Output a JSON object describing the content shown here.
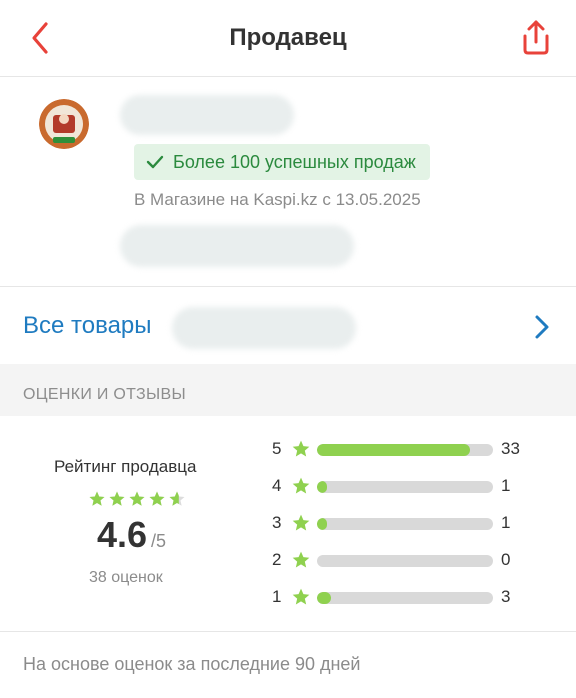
{
  "header": {
    "title": "Продавец"
  },
  "seller": {
    "badge": "Более 100 успешных продаж",
    "since": "В Магазине на Kaspi.kz с 13.05.2025"
  },
  "all_goods": {
    "label": "Все товары"
  },
  "reviews": {
    "section_title": "ОЦЕНКИ И ОТЗЫВЫ",
    "rating_title": "Рейтинг продавца",
    "score": "4.6",
    "score_max": "/5",
    "count": "38 оценок",
    "stars_filled": 4.6,
    "distribution": [
      {
        "stars": "5",
        "count": "33",
        "fraction": 0.87
      },
      {
        "stars": "4",
        "count": "1",
        "fraction": 0.03
      },
      {
        "stars": "3",
        "count": "1",
        "fraction": 0.03
      },
      {
        "stars": "2",
        "count": "0",
        "fraction": 0.0
      },
      {
        "stars": "1",
        "count": "3",
        "fraction": 0.08
      }
    ],
    "note": "На основе оценок за последние 90 дней"
  },
  "colors": {
    "accent_red": "#e8423a",
    "link_blue": "#1f7bc0",
    "star_green": "#8fd14f",
    "badge_green": "#2b8a3e"
  },
  "icons": [
    "back-arrow-icon",
    "share-icon",
    "check-icon",
    "star-icon",
    "chevron-right-icon"
  ]
}
